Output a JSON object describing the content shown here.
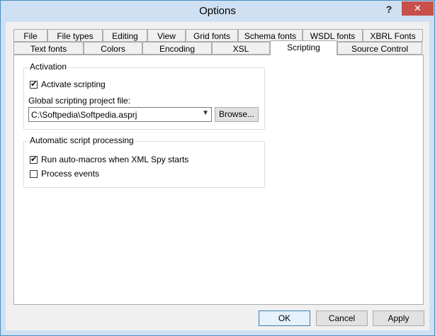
{
  "window": {
    "title": "Options",
    "help_symbol": "?",
    "close_symbol": "✕"
  },
  "tabs_row1": [
    "File",
    "File types",
    "Editing",
    "View",
    "Grid fonts",
    "Schema fonts",
    "WSDL fonts",
    "XBRL Fonts"
  ],
  "tabs_row2": [
    "Text fonts",
    "Colors",
    "Encoding",
    "XSL",
    "Scripting",
    "Source Control"
  ],
  "active_tab": "Scripting",
  "activation": {
    "label": "Activation",
    "activate_scripting": {
      "label": "Activate scripting",
      "checked": true
    },
    "project_file_label": "Global scripting project file:",
    "project_file_value": "C:\\Softpedia\\Softpedia.asprj",
    "browse_label": "Browse..."
  },
  "automatic": {
    "label": "Automatic script processing",
    "run_macros": {
      "label": "Run auto-macros when XML Spy starts",
      "checked": true
    },
    "process_events": {
      "label": "Process events",
      "checked": false
    }
  },
  "buttons": {
    "ok": "OK",
    "cancel": "Cancel",
    "apply": "Apply"
  }
}
